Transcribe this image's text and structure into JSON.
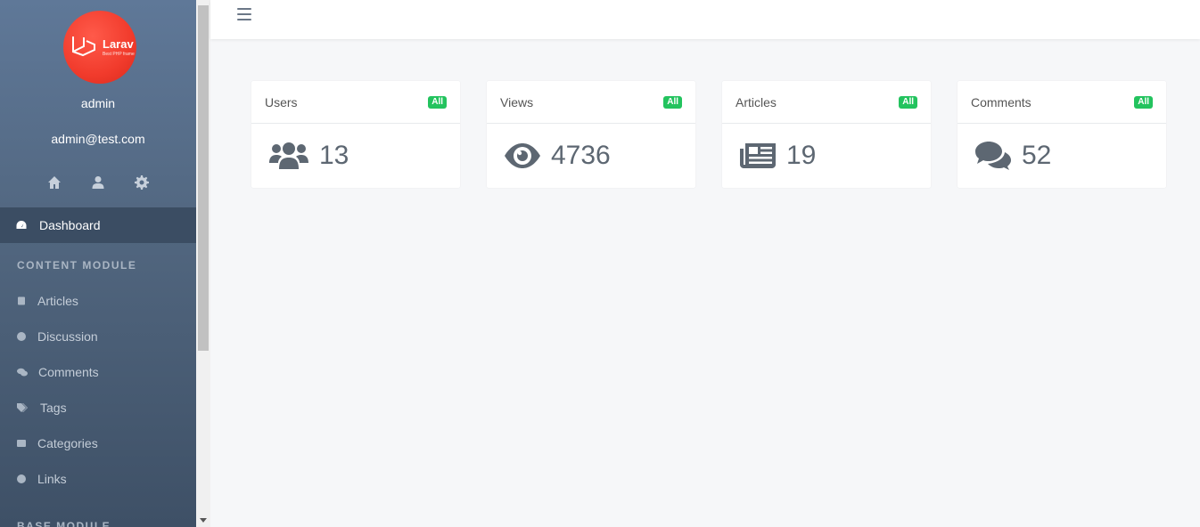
{
  "profile": {
    "logo_text": "Larav",
    "logo_subtext": "Best PHP frame",
    "name": "admin",
    "email": "admin@test.com"
  },
  "quick_icons": [
    "home-icon",
    "user-icon",
    "gear-icon"
  ],
  "nav": {
    "active": {
      "label": "Dashboard",
      "icon": "dashboard-icon"
    },
    "sections": [
      {
        "title": "CONTENT MODULE",
        "items": [
          {
            "label": "Articles",
            "icon": "book-icon"
          },
          {
            "label": "Discussion",
            "icon": "question-icon"
          },
          {
            "label": "Comments",
            "icon": "comments-icon"
          },
          {
            "label": "Tags",
            "icon": "tags-icon"
          },
          {
            "label": "Categories",
            "icon": "list-icon"
          },
          {
            "label": "Links",
            "icon": "globe-icon"
          }
        ]
      },
      {
        "title": "BASE MODULE"
      }
    ]
  },
  "cards": [
    {
      "title": "Users",
      "badge": "All",
      "value": "13",
      "icon": "users-icon"
    },
    {
      "title": "Views",
      "badge": "All",
      "value": "4736",
      "icon": "eye-icon"
    },
    {
      "title": "Articles",
      "badge": "All",
      "value": "19",
      "icon": "newspaper-icon"
    },
    {
      "title": "Comments",
      "badge": "All",
      "value": "52",
      "icon": "comments-icon"
    }
  ],
  "colors": {
    "sidebar_top": "#5f7898",
    "sidebar_bottom": "#3e5066",
    "active_item": "#3b4d63",
    "badge_green": "#23c35e",
    "avatar_red": "#f13b2c"
  }
}
